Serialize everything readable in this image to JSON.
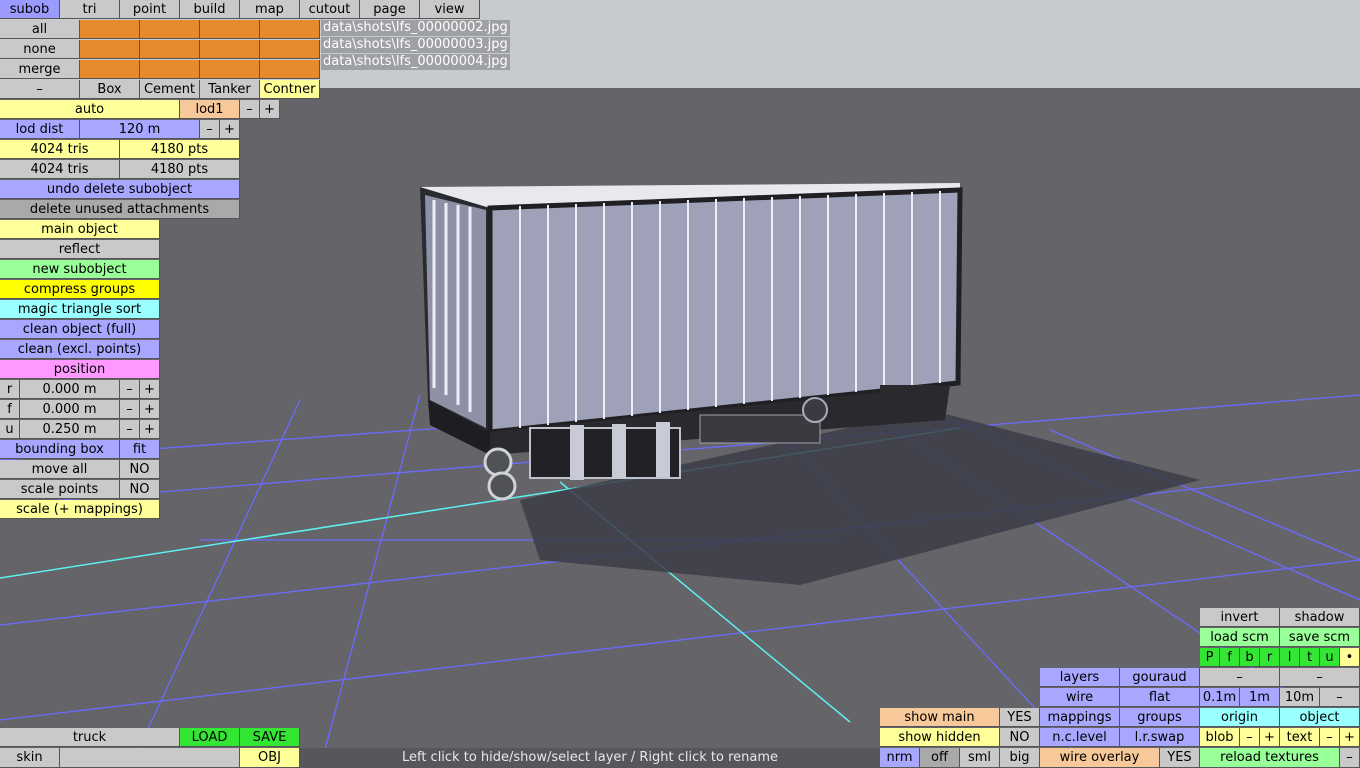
{
  "tabs": [
    "subob",
    "tri",
    "point",
    "build",
    "map",
    "cutout",
    "page",
    "view"
  ],
  "selection": {
    "all": "all",
    "none": "none",
    "merge": "merge",
    "minus": "–"
  },
  "files": [
    "data\\shots\\lfs_00000002.jpg",
    "data\\shots\\lfs_00000003.jpg",
    "data\\shots\\lfs_00000004.jpg"
  ],
  "types": [
    "Box",
    "Cement",
    "Tanker",
    "Contner"
  ],
  "lod": {
    "auto": "auto",
    "level": "lod1",
    "minus": "–",
    "plus": "+",
    "dist_label": "lod dist",
    "dist_value": "120 m"
  },
  "stats": {
    "tris1": "4024 tris",
    "pts1": "4180 pts",
    "tris2": "4024 tris",
    "pts2": "4180 pts"
  },
  "actions": {
    "undo": "undo delete subobject",
    "delete_unused": "delete unused attachments",
    "main_object": "main object",
    "reflect": "reflect",
    "new_subobject": "new subobject",
    "compress": "compress groups",
    "magic": "magic triangle sort",
    "clean_full": "clean object (full)",
    "clean_excl": "clean (excl. points)",
    "position": "position"
  },
  "position": [
    {
      "axis": "r",
      "value": "0.000 m"
    },
    {
      "axis": "f",
      "value": "0.000 m"
    },
    {
      "axis": "u",
      "value": "0.250 m"
    }
  ],
  "bbox": {
    "label": "bounding box",
    "fit": "fit",
    "move_all": "move all",
    "move_val": "NO",
    "scale_points": "scale points",
    "scale_val": "NO",
    "scale_map": "scale (+ mappings)"
  },
  "bottom_left": {
    "truck": "truck",
    "load": "LOAD",
    "save": "SAVE",
    "skin": "skin",
    "obj": "OBJ"
  },
  "status": "Left click to hide/show/select layer / Right click to rename",
  "right": {
    "invert": "invert",
    "shadow": "shadow",
    "load_scm": "load scm",
    "save_scm": "save scm",
    "letters": [
      "P",
      "f",
      "b",
      "r",
      "l",
      "t",
      "u",
      "•"
    ],
    "dash": "–",
    "layers": "layers",
    "gouraud": "gouraud",
    "wire": "wire",
    "flat": "flat",
    "mappings": "mappings",
    "groups": "groups",
    "nclevel": "n.c.level",
    "lrswap": "l.r.swap",
    "grid": [
      "0.1m",
      "1m",
      "10m",
      "–"
    ],
    "origin": "origin",
    "object": "object",
    "blob": "blob",
    "text": "text",
    "minus": "–",
    "plus": "+",
    "reload": "reload textures",
    "show_main": "show main",
    "show_main_val": "YES",
    "show_hidden": "show hidden",
    "show_hidden_val": "NO",
    "wire_overlay": "wire overlay",
    "wire_overlay_val": "YES",
    "sizes": [
      "nrm",
      "off",
      "sml",
      "big"
    ]
  }
}
